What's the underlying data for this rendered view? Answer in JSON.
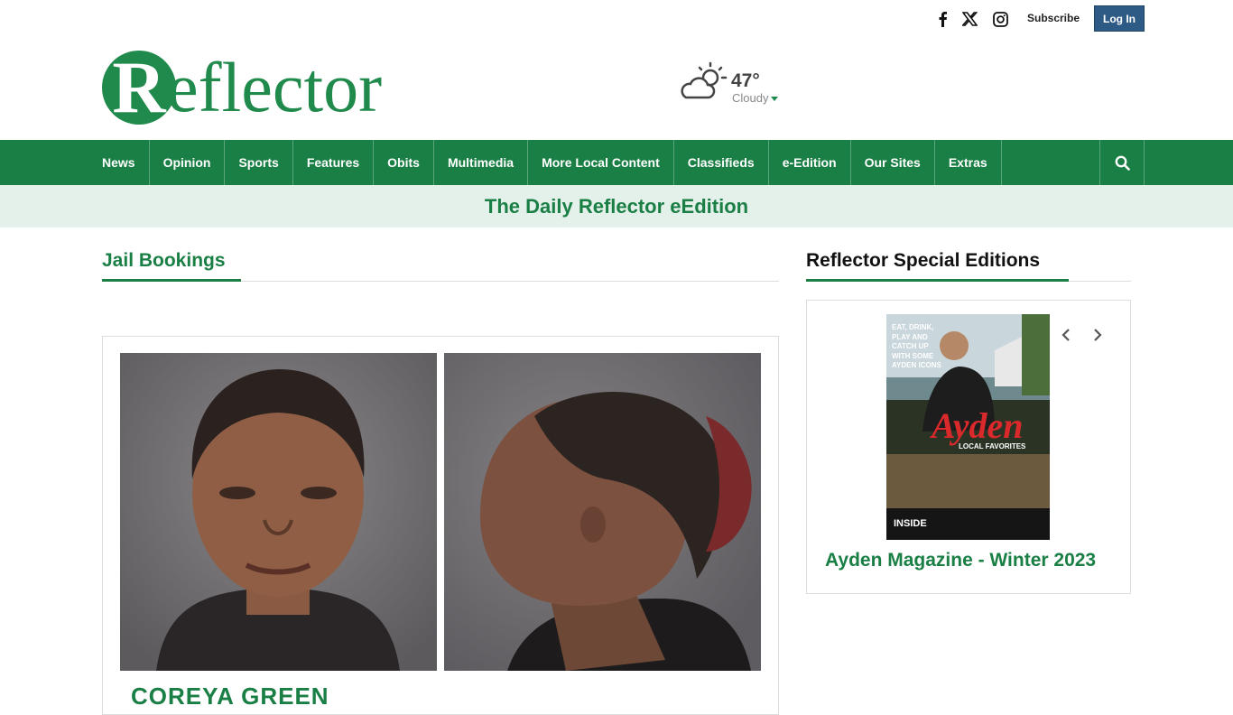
{
  "header": {
    "social_icons": [
      "facebook-icon",
      "x-twitter-icon",
      "instagram-icon"
    ],
    "subscribe_label": "Subscribe",
    "login_label": "Log In",
    "logo_initial": "R",
    "logo_rest": "eflector",
    "weather": {
      "icon": "partly-cloudy-icon",
      "temperature": "47°",
      "condition": "Cloudy"
    }
  },
  "nav": {
    "items": [
      "News",
      "Opinion",
      "Sports",
      "Features",
      "Obits",
      "Multimedia",
      "More Local Content",
      "Classifieds",
      "e-Edition",
      "Our Sites",
      "Extras"
    ],
    "search_icon": "search-icon"
  },
  "banner": {
    "text": "The Daily Reflector eEdition"
  },
  "main": {
    "section_title": "Jail Bookings",
    "booking": {
      "name": "COREYA GREEN"
    }
  },
  "sidebar": {
    "section_title": "Reflector Special Editions",
    "magazine": {
      "cover_tagline": [
        "EAT, DRINK,",
        "PLAY AND",
        "CATCH UP",
        "WITH SOME",
        "AYDEN ICONS"
      ],
      "cover_title": "Ayden",
      "cover_subtitle": "LOCAL FAVORITES",
      "cover_inside": "INSIDE",
      "title": "Ayden Magazine - Winter 2023"
    }
  },
  "colors": {
    "brand_green": "#1a7f45",
    "login_blue": "#2e5b86",
    "banner_bg": "#e4f1ea"
  }
}
